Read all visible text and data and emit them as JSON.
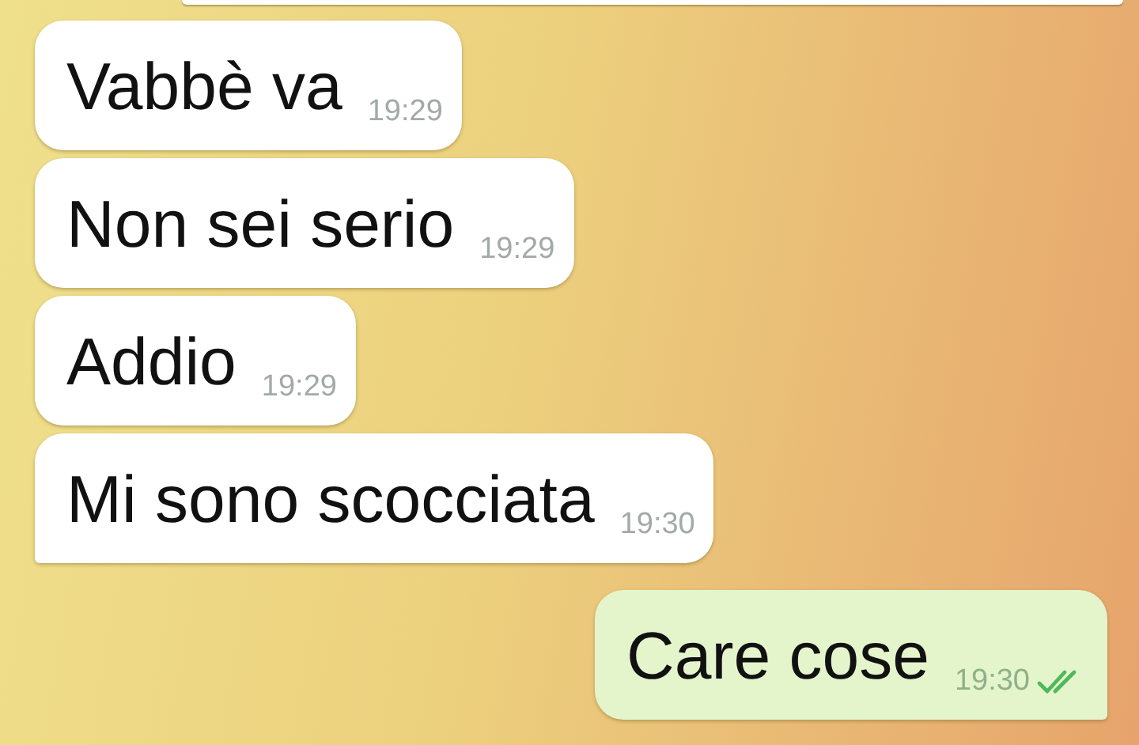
{
  "messages": [
    {
      "outgoing": false,
      "text": "Vabbè va",
      "time": "19:29",
      "tail": false
    },
    {
      "outgoing": false,
      "text": "Non sei serio",
      "time": "19:29",
      "tail": false
    },
    {
      "outgoing": false,
      "text": "Addio",
      "time": "19:29",
      "tail": false
    },
    {
      "outgoing": false,
      "text": "Mi sono scocciata",
      "time": "19:30",
      "tail": true
    },
    {
      "outgoing": true,
      "text": "Care cose",
      "time": "19:30",
      "tail": true,
      "read": true
    }
  ]
}
